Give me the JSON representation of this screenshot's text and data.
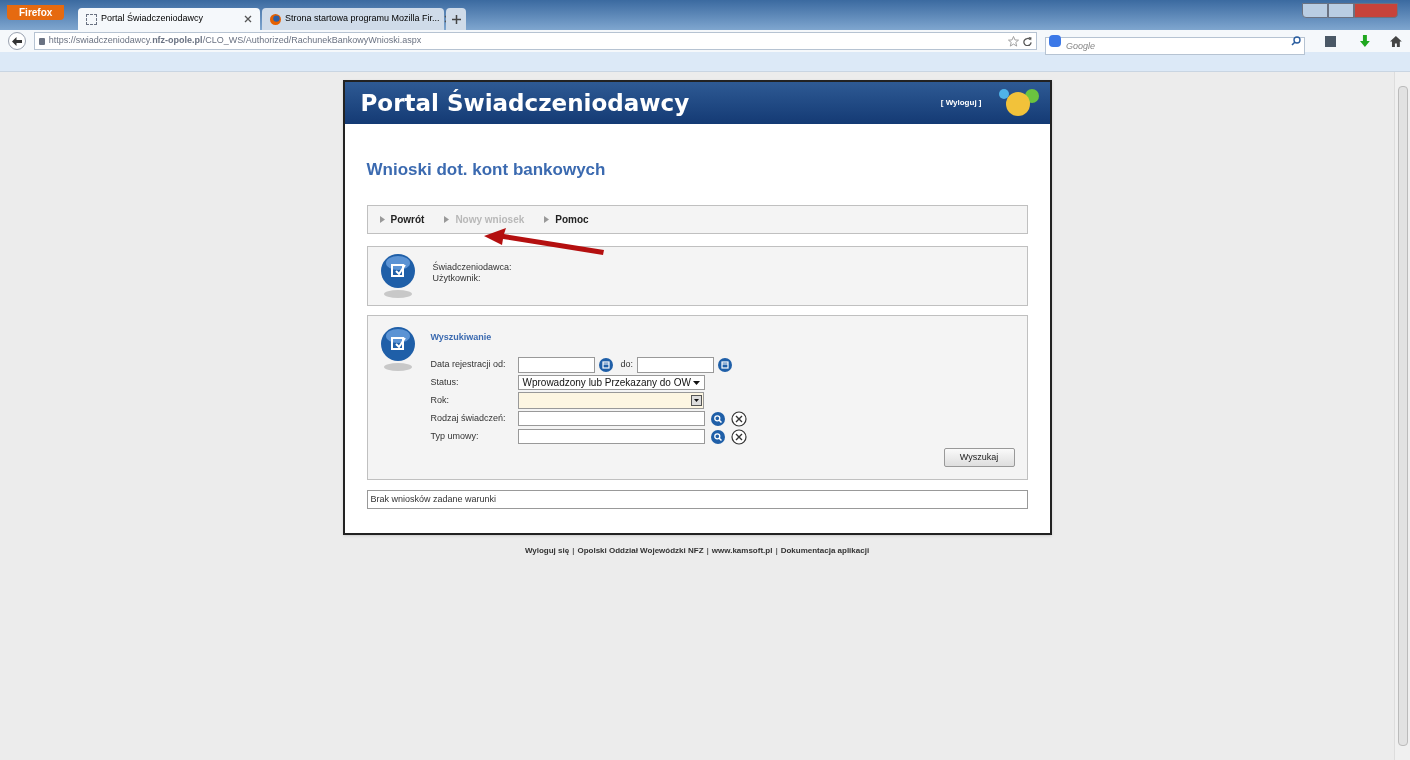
{
  "browser": {
    "menu_button": "Firefox",
    "tabs": [
      {
        "title": "Portal Świadczeniodawcy",
        "selected": true,
        "kind": "blank"
      },
      {
        "title": "Strona startowa programu Mozilla Fir...",
        "selected": false,
        "kind": "firefox"
      }
    ],
    "url": {
      "prefix": "https://swiadczeniodawcy.",
      "domain": "nfz-opole.pl",
      "path": "/CLO_WS/Authorized/RachunekBankowyWnioski.aspx"
    },
    "search": {
      "placeholder": "Google"
    }
  },
  "page": {
    "header": {
      "title": "Portal Świadczeniodawcy",
      "logout": "[ Wyloguj ]"
    },
    "heading": "Wnioski dot. kont bankowych",
    "nav": [
      {
        "label": "Powrót",
        "disabled": false
      },
      {
        "label": "Nowy wniosek",
        "disabled": true
      },
      {
        "label": "Pomoc",
        "disabled": false
      }
    ],
    "info": {
      "labels": [
        "Świadczeniodawca:",
        "Użytkownik:"
      ]
    },
    "search": {
      "title": "Wyszukiwanie",
      "fields": [
        {
          "kind": "date_range",
          "label": "Data rejestracji od:",
          "to_label": "do:"
        },
        {
          "kind": "select",
          "label": "Status:",
          "value": "Wprowadzony lub Przekazany do OW"
        },
        {
          "kind": "combo",
          "label": "Rok:"
        },
        {
          "kind": "lookup",
          "label": "Rodzaj świadczeń:"
        },
        {
          "kind": "lookup",
          "label": "Typ umowy:"
        }
      ],
      "button": "Wyszukaj"
    },
    "result": "Brak wniosków zadane warunki",
    "footer": [
      {
        "kind": "link",
        "text": "Wyloguj się"
      },
      {
        "kind": "separator",
        "text": "|"
      },
      {
        "kind": "link",
        "text": "Opolski Oddział Wojewódzki NFZ"
      },
      {
        "kind": "separator",
        "text": "|"
      },
      {
        "kind": "link",
        "text": "www.kamsoft.pl"
      },
      {
        "kind": "separator",
        "text": "|"
      },
      {
        "kind": "link",
        "text": "Dokumentacja aplikacji"
      }
    ]
  }
}
